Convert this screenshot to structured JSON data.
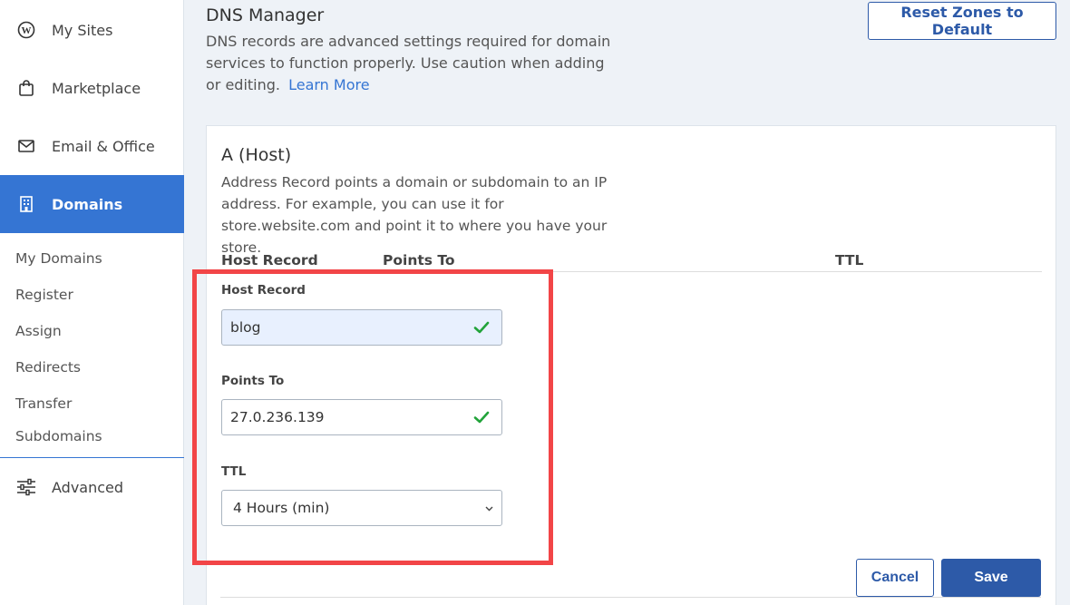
{
  "sidebar": {
    "items": [
      {
        "label": "My Sites",
        "icon": "wordpress-icon"
      },
      {
        "label": "Marketplace",
        "icon": "shopping-bag-icon"
      },
      {
        "label": "Email & Office",
        "icon": "envelope-icon"
      },
      {
        "label": "Domains",
        "icon": "building-icon"
      }
    ],
    "sub_items": [
      "My Domains",
      "Register",
      "Assign",
      "Redirects",
      "Transfer",
      "Subdomains"
    ],
    "advanced": {
      "label": "Advanced",
      "icon": "sliders-icon"
    }
  },
  "header": {
    "title": "DNS Manager",
    "description": "DNS records are advanced settings required for domain services to function properly. Use caution when adding or editing.",
    "learn_more": "Learn More",
    "reset_button": "Reset Zones to Default"
  },
  "record_card": {
    "title": "A (Host)",
    "description": "Address Record points a domain or subdomain to an IP address. For example, you can use it for store.website.com and point it to where you have your store.",
    "columns": [
      "Host Record",
      "Points To",
      "TTL"
    ],
    "form": {
      "host_record_label": "Host Record",
      "host_record_value": "blog",
      "points_to_label": "Points To",
      "points_to_value": "27.0.236.139",
      "ttl_label": "TTL",
      "ttl_value": "4 Hours (min)"
    },
    "cancel_button": "Cancel",
    "save_button": "Save"
  },
  "colors": {
    "accent": "#3575d3",
    "button_primary": "#2d5aa8",
    "highlight": "#f24547",
    "valid": "#22a33a"
  }
}
